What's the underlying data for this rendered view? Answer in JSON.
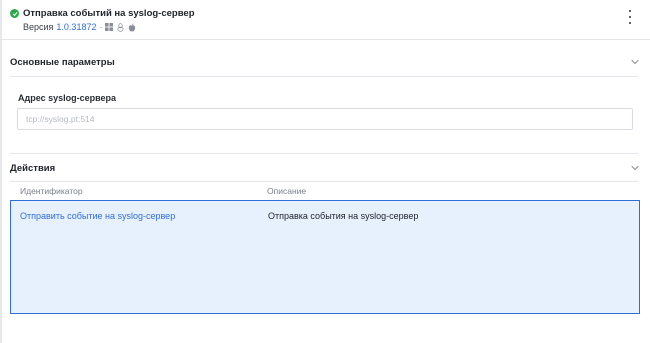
{
  "header": {
    "title": "Отправка событий на syslog-сервер",
    "version_label": "Версия",
    "version_value": "1.0.31872",
    "separator": "·",
    "status_color": "#2ba84a",
    "os_icons": [
      "windows-icon",
      "linux-icon",
      "apple-icon"
    ]
  },
  "params_section": {
    "title": "Основные параметры",
    "field_label": "Адрес syslog-сервера",
    "field_value": "",
    "field_placeholder": "tcp://syslog.pt:514"
  },
  "actions_section": {
    "title": "Действия",
    "columns": [
      "Идентификатор",
      "Описание"
    ],
    "rows": [
      {
        "id": "Отправить событие на syslog-сервер",
        "description": "Отправка события на syslog-сервер"
      }
    ]
  },
  "colors": {
    "accent": "#2f6fd6",
    "row_selected_bg": "#e7f0fd",
    "divider": "#e3e6ea"
  }
}
